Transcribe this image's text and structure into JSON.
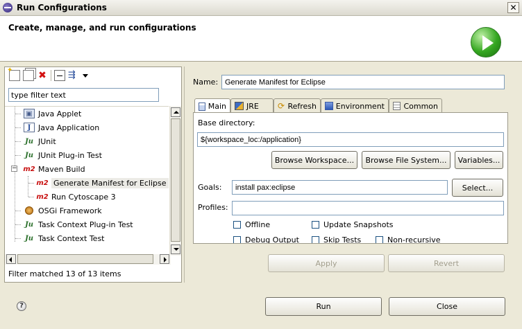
{
  "window": {
    "title": "Run Configurations",
    "close_glyph": "✕"
  },
  "header": {
    "title": "Create, manage, and run configurations"
  },
  "left": {
    "filter_placeholder": "type filter text",
    "filter_value": "type filter text",
    "tree": [
      {
        "label": "Java Applet",
        "icon": "java-applet-icon"
      },
      {
        "label": "Java Application",
        "icon": "java-application-icon"
      },
      {
        "label": "JUnit",
        "icon": "junit-icon"
      },
      {
        "label": "JUnit Plug-in Test",
        "icon": "junit-plugin-icon"
      },
      {
        "label": "Maven Build",
        "icon": "maven-icon",
        "expanded": true
      },
      {
        "label": "Generate Manifest for Eclipse",
        "icon": "maven-icon",
        "selected": true
      },
      {
        "label": "Run Cytoscape 3",
        "icon": "maven-icon"
      },
      {
        "label": "OSGi Framework",
        "icon": "osgi-icon"
      },
      {
        "label": "Task Context Plug-in Test",
        "icon": "task-context-plugin-icon"
      },
      {
        "label": "Task Context Test",
        "icon": "task-context-test-icon"
      }
    ],
    "status": "Filter matched 13 of 13 items"
  },
  "right": {
    "name_label": "Name:",
    "name_value": "Generate Manifest for Eclipse",
    "tabs": [
      {
        "label": "Main",
        "active": true
      },
      {
        "label": "JRE"
      },
      {
        "label": "Refresh"
      },
      {
        "label": "Environment"
      },
      {
        "label": "Common"
      }
    ],
    "main": {
      "base_dir_label": "Base directory:",
      "base_dir_value": "${workspace_loc:/application}",
      "browse_workspace": "Browse Workspace...",
      "browse_fs": "Browse File System...",
      "variables": "Variables...",
      "goals_label": "Goals:",
      "goals_value": "install pax:eclipse",
      "select": "Select...",
      "profiles_label": "Profiles:",
      "profiles_value": "",
      "checks": {
        "offline": "Offline",
        "update_snapshots": "Update Snapshots",
        "debug_output": "Debug Output",
        "skip_tests": "Skip Tests",
        "non_recursive": "Non-recursive"
      }
    },
    "apply": "Apply",
    "revert": "Revert"
  },
  "footer": {
    "help": "?",
    "run": "Run",
    "close": "Close"
  }
}
